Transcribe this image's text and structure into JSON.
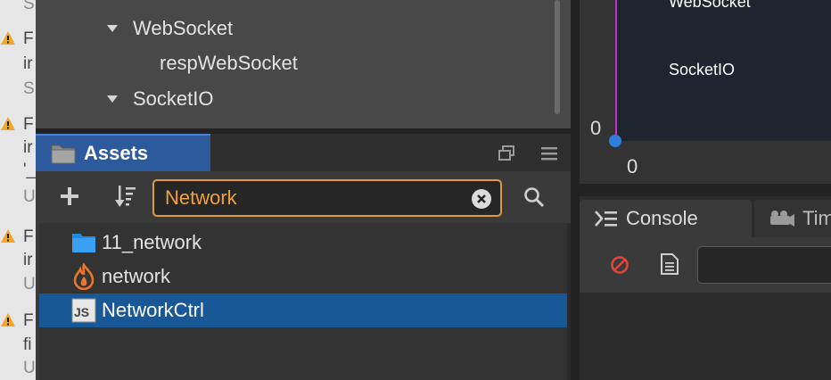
{
  "log_panel": {
    "rows": [
      {
        "warn": false,
        "char": "S"
      },
      {
        "warn": true,
        "char": "F"
      },
      {
        "warn": false,
        "char": "ir"
      },
      {
        "warn": false,
        "char": "S"
      },
      {
        "warn": true,
        "char": "F"
      },
      {
        "warn": false,
        "char": "ir"
      },
      {
        "warn": false,
        "char": "'_"
      },
      {
        "warn": false,
        "char": "U"
      },
      {
        "warn": true,
        "char": "F"
      },
      {
        "warn": false,
        "char": "ir"
      },
      {
        "warn": false,
        "char": "U"
      },
      {
        "warn": true,
        "char": "F"
      },
      {
        "warn": false,
        "char": "fi"
      },
      {
        "warn": false,
        "char": "U"
      }
    ]
  },
  "hierarchy": {
    "items": [
      {
        "label": "WebSocket",
        "expanded": true,
        "indent": 1
      },
      {
        "label": "respWebSocket",
        "expanded": false,
        "indent": 2
      },
      {
        "label": "SocketIO",
        "expanded": true,
        "indent": 1
      }
    ]
  },
  "assets": {
    "tab_label": "Assets",
    "search": {
      "value": "Network",
      "placeholder": ""
    },
    "items": [
      {
        "label": "11_network",
        "icon": "folder-icon",
        "selected": false
      },
      {
        "label": "network",
        "icon": "fire-icon",
        "selected": false
      },
      {
        "label": "NetworkCtrl",
        "icon": "js-file-icon",
        "selected": true
      }
    ]
  },
  "scene": {
    "labels": [
      "WebSocket",
      "SocketIO"
    ],
    "axis_x": "0",
    "axis_y": "0"
  },
  "console": {
    "tab_label": "Console",
    "next_tab_label": "Tim",
    "filter_value": ""
  },
  "colors": {
    "accent": "#2d5a9d",
    "selection": "#185896",
    "search_border": "#e09b3d",
    "search_text": "#f2a03d",
    "warning": "#f5a623",
    "origin": "#2f7fde",
    "scene_axis": "#c234c9"
  }
}
